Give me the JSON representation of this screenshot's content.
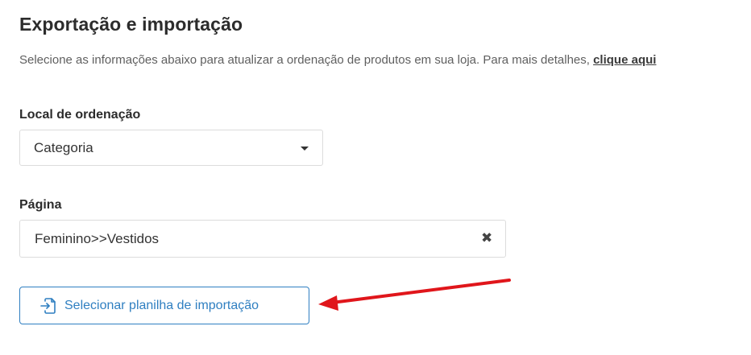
{
  "header": {
    "title": "Exportação e importação"
  },
  "description": {
    "text": "Selecione as informações abaixo para atualizar a ordenação de produtos em sua loja. Para mais detalhes, ",
    "link_label": "clique aqui"
  },
  "form": {
    "local": {
      "label": "Local de ordenação",
      "value": "Categoria",
      "caret_icon": "caret-down-icon"
    },
    "pagina": {
      "label": "Página",
      "value": "Feminino>>Vestidos",
      "clear_icon": "close-icon"
    },
    "import_button": {
      "label": "Selecionar planilha de importação",
      "icon": "file-import-icon"
    }
  },
  "annotation": {
    "arrow_color": "#e0161b",
    "accent_color": "#2f7fc1"
  }
}
